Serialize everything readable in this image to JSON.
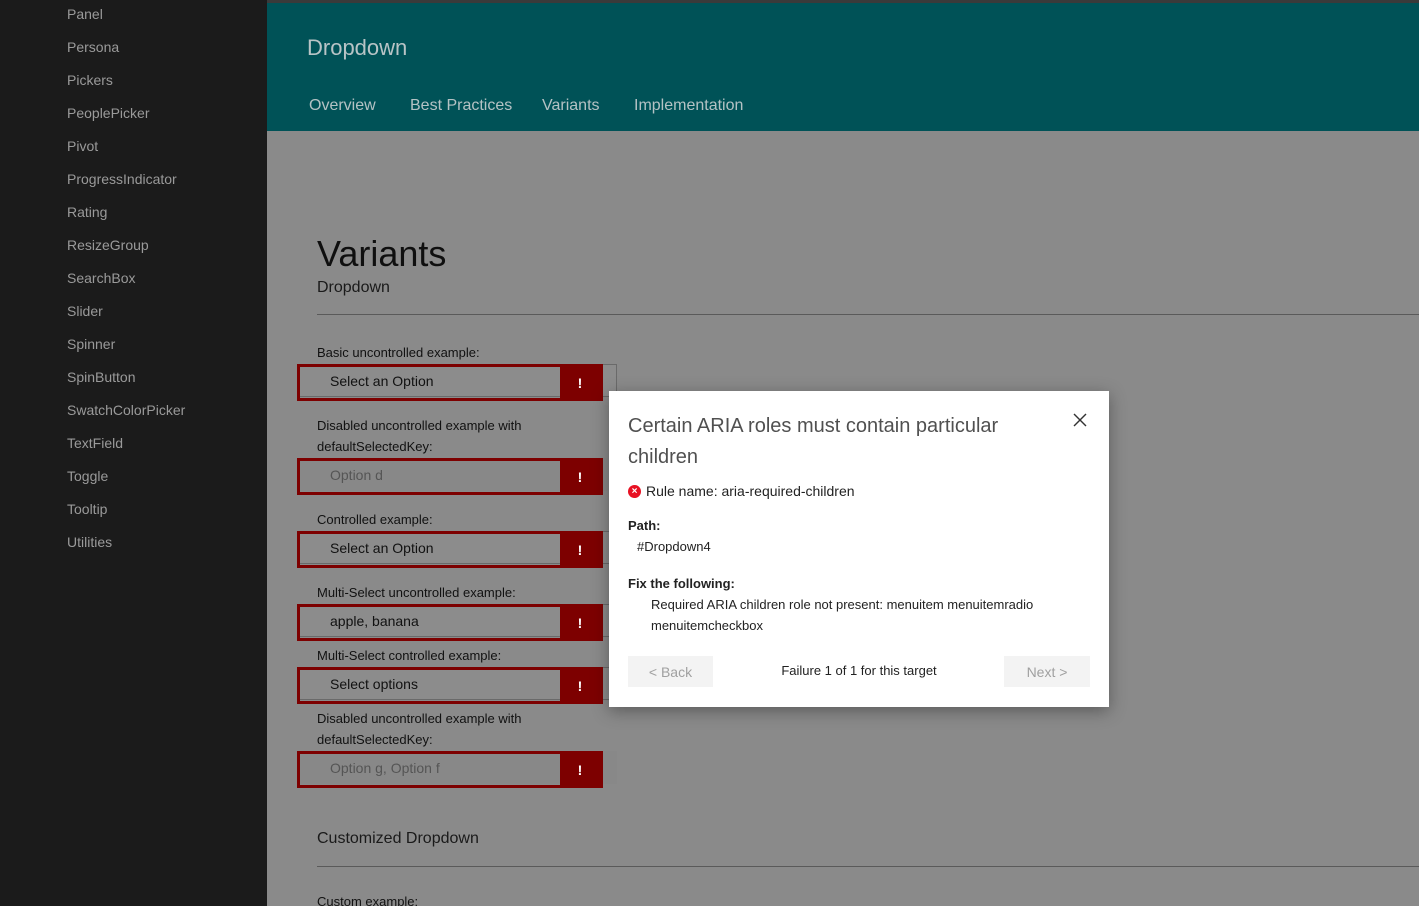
{
  "sidebar": {
    "items": [
      {
        "label": "Panel"
      },
      {
        "label": "Persona"
      },
      {
        "label": "Pickers"
      },
      {
        "label": "PeoplePicker"
      },
      {
        "label": "Pivot"
      },
      {
        "label": "ProgressIndicator"
      },
      {
        "label": "Rating"
      },
      {
        "label": "ResizeGroup"
      },
      {
        "label": "SearchBox"
      },
      {
        "label": "Slider"
      },
      {
        "label": "Spinner"
      },
      {
        "label": "SpinButton"
      },
      {
        "label": "SwatchColorPicker"
      },
      {
        "label": "TextField"
      },
      {
        "label": "Toggle"
      },
      {
        "label": "Tooltip"
      },
      {
        "label": "Utilities"
      }
    ]
  },
  "header": {
    "title": "Dropdown",
    "tabs": [
      {
        "label": "Overview"
      },
      {
        "label": "Best Practices"
      },
      {
        "label": "Variants"
      },
      {
        "label": "Implementation"
      }
    ]
  },
  "main": {
    "page_title": "Variants",
    "section1_title": "Dropdown",
    "section2_title": "Customized Dropdown",
    "custom_example_label": "Custom example:",
    "examples": [
      {
        "label": "Basic uncontrolled example:",
        "value": "Select an Option"
      },
      {
        "label": "Disabled uncontrolled example with defaultSelectedKey:",
        "value": "Option d"
      },
      {
        "label": "Controlled example:",
        "value": "Select an Option"
      },
      {
        "label": "Multi-Select uncontrolled example:",
        "value": "apple, banana"
      },
      {
        "label": "Multi-Select controlled example:",
        "value": "Select options"
      },
      {
        "label": "Disabled uncontrolled example with defaultSelectedKey:",
        "value": "Option g, Option f"
      }
    ],
    "error_badge": "!"
  },
  "dialog": {
    "title": "Certain ARIA roles must contain particular children",
    "rule_name": "Rule name: aria-required-children",
    "path_label": "Path:",
    "path_value": "#Dropdown4",
    "fix_label": "Fix the following:",
    "fix_text": "Required ARIA children role not present: menuitem menuitemradio menuitemcheckbox",
    "back_label": "< Back",
    "next_label": "Next >",
    "status": "Failure 1 of 1 for this target",
    "error_icon_glyph": "×"
  },
  "colors": {
    "header_bg": "#005257",
    "sidebar_bg": "#1b1b1b",
    "error_red": "#7d0000",
    "error_icon": "#e81123"
  }
}
